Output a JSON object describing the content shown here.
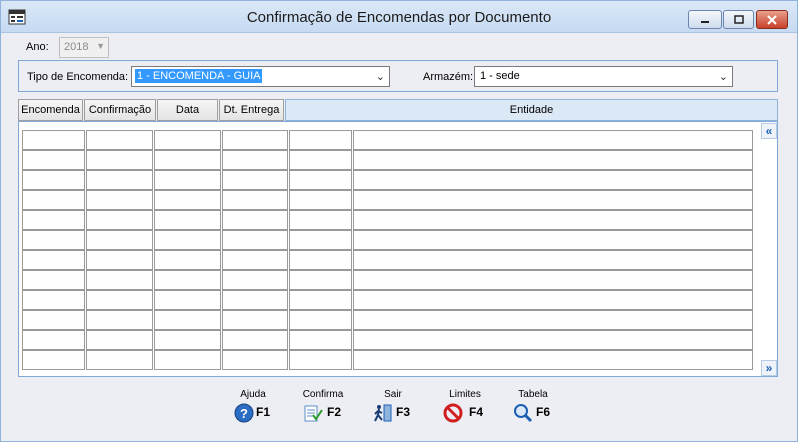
{
  "window": {
    "title": "Confirmação de Encomendas por Documento"
  },
  "filters": {
    "ano_label": "Ano:",
    "ano_value": "2018",
    "tipo_label": "Tipo de Encomenda:",
    "tipo_value": "1 - ENCOMENDA - GUIA",
    "armazem_label": "Armazém:",
    "armazem_value": "1 - sede"
  },
  "table": {
    "columns": [
      "Encomenda",
      "Confirmação",
      "Data",
      "Dt. Entrega",
      "Entidade"
    ],
    "row_count": 12
  },
  "footer": {
    "buttons": [
      {
        "label": "Ajuda",
        "key": "F1",
        "icon": "help-icon"
      },
      {
        "label": "Confirma",
        "key": "F2",
        "icon": "confirm-icon"
      },
      {
        "label": "Sair",
        "key": "F3",
        "icon": "exit-icon"
      },
      {
        "label": "Limites",
        "key": "F4",
        "icon": "limits-icon"
      },
      {
        "label": "Tabela",
        "key": "F6",
        "icon": "table-search-icon"
      }
    ]
  },
  "colors": {
    "accent": "#3399ff",
    "border_blue": "#7fa8d6",
    "close_red": "#c7412a"
  }
}
